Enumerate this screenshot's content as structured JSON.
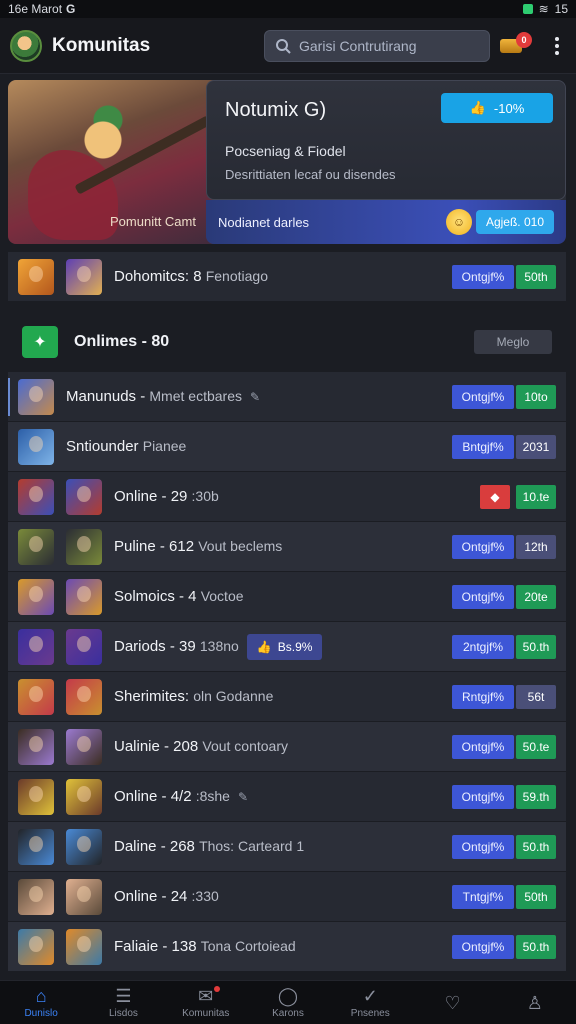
{
  "status": {
    "time": "16e Marot",
    "battery": "15"
  },
  "header": {
    "title": "Komunitas",
    "search_placeholder": "Garisi Contrutirang",
    "coin_badge": "0"
  },
  "hero": {
    "caption": "Pomunitt Camt",
    "title": "Notumix G)",
    "pill": "-10%",
    "subtitle": "Pocseniag & Fiodel",
    "description": "Desrittiaten lecaf ou disendes",
    "footer_text": "Nodianet darles",
    "footer_pill": "Agjeß. 010"
  },
  "top_row": {
    "label": "Dohomitcs: 8",
    "muted": "Fenotiago",
    "blue": "Ontgjf%",
    "green": "50th"
  },
  "section": {
    "title": "Onlimes - 80",
    "button": "Meglo"
  },
  "rows": [
    {
      "label": "Manunuds -",
      "muted": "Mmet ectbares",
      "blue": "Ontgjf%",
      "right": "10to",
      "rtype": "green",
      "pen": "✎"
    },
    {
      "label": "Sntiounder",
      "muted": "Pianee",
      "blue": "Bntgjf%",
      "right": "2031",
      "rtype": "slate"
    },
    {
      "label": "Online - 29",
      "muted": ":30b",
      "blue": "",
      "right": "10.te",
      "rtype": "green",
      "red": "◆"
    },
    {
      "label": "Puline - 612",
      "muted": "Vout beclems",
      "blue": "Ontgjf%",
      "right": "12th",
      "rtype": "slate"
    },
    {
      "label": "Solmoics - 4",
      "muted": "Voctoe",
      "blue": "Ontgjf%",
      "right": "20te",
      "rtype": "green"
    },
    {
      "label": "Dariods - 39",
      "muted": "138no",
      "blue": "2ntgjf%",
      "right": "50.th",
      "rtype": "green",
      "mid": "Bs.9%"
    },
    {
      "label": "Sherimites:",
      "muted": "oln Godanne",
      "blue": "Rntgjf%",
      "right": "56t",
      "rtype": "slate"
    },
    {
      "label": "Ualinie - 208",
      "muted": "Vout contoary",
      "blue": "Ontgjf%",
      "right": "50.te",
      "rtype": "green"
    },
    {
      "label": "Online - 4/2",
      "muted": ":8she",
      "blue": "Ontgjf%",
      "right": "59.th",
      "rtype": "green",
      "pen": "✎"
    },
    {
      "label": "Daline - 268",
      "muted": "Thos: Carteard 1",
      "blue": "Ontgjf%",
      "right": "50.th",
      "rtype": "green"
    },
    {
      "label": "Online - 24",
      "muted": ":330",
      "blue": "Tntgjf%",
      "right": "50th",
      "rtype": "green"
    },
    {
      "label": "Faliaie - 138",
      "muted": "Tona Cortoiead",
      "blue": "Ontgjf%",
      "right": "50.th",
      "rtype": "green"
    }
  ],
  "nav": [
    {
      "label": "Dunislo",
      "glyph": "⌂"
    },
    {
      "label": "Lisdos",
      "glyph": "☰"
    },
    {
      "label": "Komunitas",
      "glyph": "✉"
    },
    {
      "label": "Karons",
      "glyph": "◯"
    },
    {
      "label": "Pnsenes",
      "glyph": "✓"
    },
    {
      "label": "",
      "glyph": "♡"
    },
    {
      "label": "",
      "glyph": "♙"
    }
  ]
}
